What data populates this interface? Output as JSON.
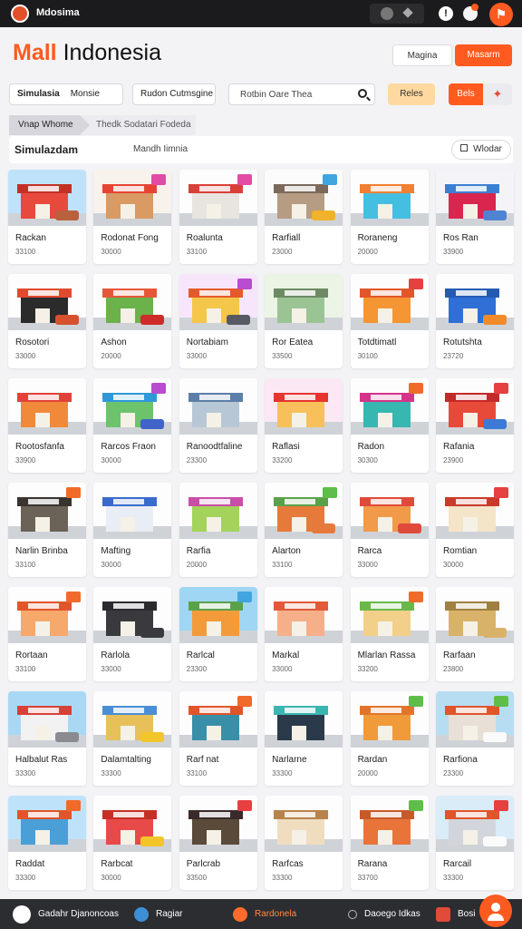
{
  "topbar": {
    "title": "Mdosima"
  },
  "header": {
    "title_accent": "Mall",
    "title_rest": "Indonesia",
    "btn_light": "Magina",
    "btn_dark": "Masarm"
  },
  "toolbar": {
    "tab1_bold": "Simulasia",
    "tab1_rest": "Monsie",
    "tab2": "Rudon Cutmsgine",
    "search_placeholder": "Rotbin Oare Thea",
    "filter": "Reles",
    "go": "Bels"
  },
  "breadcrumb": {
    "first": "Vnap Whome",
    "second": "Thedk Sodatari  Fodeda"
  },
  "section": {
    "title": "Simulazdam",
    "subtitle": "Mandh Iimnia",
    "button": "Wlodar"
  },
  "colors": {
    "accent": "#ff5a1f",
    "topbar": "#1b1b1d",
    "bottombar": "#2b2d31"
  },
  "items": [
    {
      "name": "Rackan",
      "price": "33100",
      "sky": "#bfe2fb",
      "body": "#e8493d",
      "roof": "#c43025",
      "car": "#b9603e",
      "badge": ""
    },
    {
      "name": "Rodonat Fong",
      "price": "30000",
      "sky": "#f7f3ec",
      "body": "#d99a63",
      "roof": "#e74533",
      "car": "",
      "badge": "#e24ba6"
    },
    {
      "name": "Roalunta",
      "price": "33100",
      "sky": "#fdfdfd",
      "body": "#e8e4df",
      "roof": "#d94038",
      "car": "",
      "badge": "#e24ba6"
    },
    {
      "name": "Rarfiall",
      "price": "23000",
      "sky": "#fbfbfb",
      "body": "#b59c82",
      "roof": "#7b6a5a",
      "car": "#f0b12b",
      "badge": "#41a5e0"
    },
    {
      "name": "Roraneng",
      "price": "20000",
      "sky": "#fdfdfd",
      "body": "#45bfe1",
      "roof": "#f37f30",
      "car": "",
      "badge": ""
    },
    {
      "name": "Ros Ran",
      "price": "33900",
      "sky": "#f4f4f8",
      "body": "#d8264e",
      "roof": "#3b7fd4",
      "car": "#4f83d1",
      "badge": ""
    },
    {
      "name": "Rosotori",
      "price": "33000",
      "sky": "#fdfdfd",
      "body": "#2b2b2b",
      "roof": "#e24a2e",
      "car": "#d6522f",
      "badge": ""
    },
    {
      "name": "Ashon",
      "price": "20000",
      "sky": "#fdfdfd",
      "body": "#6bb24a",
      "roof": "#e6573a",
      "car": "#cf2b2b",
      "badge": ""
    },
    {
      "name": "Nortabiam",
      "price": "33000",
      "sky": "#f7e6fb",
      "body": "#f4c64a",
      "roof": "#e45a2c",
      "car": "#575a63",
      "badge": "#b84dcf"
    },
    {
      "name": "Ror Eatea",
      "price": "33500",
      "sky": "#ecf4e6",
      "body": "#9ac493",
      "roof": "#6d8a64",
      "car": "",
      "badge": ""
    },
    {
      "name": "Totdtimatl",
      "price": "30100",
      "sky": "#fdfdfd",
      "body": "#f59534",
      "roof": "#e3552a",
      "car": "",
      "badge": "#e74040"
    },
    {
      "name": "Rotutshta",
      "price": "23720",
      "sky": "#fdfdfd",
      "body": "#2f6fd6",
      "roof": "#245bb2",
      "car": "#f08a2a",
      "badge": ""
    },
    {
      "name": "Rootosfanfa",
      "price": "33900",
      "sky": "#fdfdfd",
      "body": "#f08a3a",
      "roof": "#e2423a",
      "car": "",
      "badge": ""
    },
    {
      "name": "Rarcos Fraon",
      "price": "30000",
      "sky": "#fdfdfd",
      "body": "#6dc36b",
      "roof": "#2e98d9",
      "car": "#3f63c8",
      "badge": "#b84dcf"
    },
    {
      "name": "Ranoodtfaline",
      "price": "23300",
      "sky": "#fdfdfd",
      "body": "#b8c7d6",
      "roof": "#5b7fa8",
      "car": "",
      "badge": ""
    },
    {
      "name": "Raflasi",
      "price": "33200",
      "sky": "#fbe8f4",
      "body": "#f7c05a",
      "roof": "#e4352f",
      "car": "",
      "badge": ""
    },
    {
      "name": "Radon",
      "price": "30300",
      "sky": "#fdfdfd",
      "body": "#37b7b0",
      "roof": "#d6338a",
      "car": "",
      "badge": "#f06a2a"
    },
    {
      "name": "Rafania",
      "price": "23900",
      "sky": "#fdfdfd",
      "body": "#e84a3a",
      "roof": "#c32a2a",
      "car": "#3d7ad6",
      "badge": "#e74040"
    },
    {
      "name": "Narlin Brinba",
      "price": "33100",
      "sky": "#fdfdfd",
      "body": "#6b6258",
      "roof": "#3a342f",
      "car": "",
      "badge": "#f06a2a"
    },
    {
      "name": "Mafting",
      "price": "30000",
      "sky": "#fdfdfd",
      "body": "#e9eef6",
      "roof": "#3a6bcc",
      "car": "",
      "badge": ""
    },
    {
      "name": "Rarfia",
      "price": "20000",
      "sky": "#fdfdfd",
      "body": "#a3d35a",
      "roof": "#c94ea8",
      "car": "",
      "badge": ""
    },
    {
      "name": "Alarton",
      "price": "33100",
      "sky": "#fdfdfd",
      "body": "#e67a3a",
      "roof": "#5aa24a",
      "car": "#e67a3a",
      "badge": "#5fbe4a"
    },
    {
      "name": "Rarca",
      "price": "33000",
      "sky": "#fdfdfd",
      "body": "#f09a4a",
      "roof": "#e04a3a",
      "car": "#e04a3a",
      "badge": ""
    },
    {
      "name": "Romtian",
      "price": "30000",
      "sky": "#fdfdfd",
      "body": "#f4e4c8",
      "roof": "#c93a2a",
      "car": "",
      "badge": "#e74040"
    },
    {
      "name": "Rortaan",
      "price": "33100",
      "sky": "#fdfdfd",
      "body": "#f6a96a",
      "roof": "#e2542a",
      "car": "",
      "badge": "#f06a2a"
    },
    {
      "name": "Rarlola",
      "price": "33000",
      "sky": "#fdfdfd",
      "body": "#3a3a3e",
      "roof": "#2a2a2e",
      "car": "#3a3a3e",
      "badge": ""
    },
    {
      "name": "Rarlcal",
      "price": "23300",
      "sky": "#9fd6f3",
      "body": "#f39b3a",
      "roof": "#5aa24a",
      "car": "",
      "badge": "#41a5e0"
    },
    {
      "name": "Markal",
      "price": "33000",
      "sky": "#fdfdfd",
      "body": "#f5b08a",
      "roof": "#e25a3a",
      "car": "",
      "badge": ""
    },
    {
      "name": "Mlarlan Rassa",
      "price": "33200",
      "sky": "#fdfdfd",
      "body": "#f2d08a",
      "roof": "#6ab84a",
      "car": "",
      "badge": "#f06a2a"
    },
    {
      "name": "Rarfaan",
      "price": "23800",
      "sky": "#fdfdfd",
      "body": "#d9b26a",
      "roof": "#a08040",
      "car": "#d9b26a",
      "badge": ""
    },
    {
      "name": "Halbalut Ras",
      "price": "33300",
      "sky": "#a9d8f5",
      "body": "#f2f2f2",
      "roof": "#d94038",
      "car": "#8a8a90",
      "badge": ""
    },
    {
      "name": "Dalamtalting",
      "price": "33300",
      "sky": "#fdfdfd",
      "body": "#e7c05a",
      "roof": "#4a8fd6",
      "car": "#f2c52a",
      "badge": ""
    },
    {
      "name": "Rarf nat",
      "price": "33100",
      "sky": "#fdfdfd",
      "body": "#3a8fa8",
      "roof": "#e2542a",
      "car": "",
      "badge": "#f06a2a"
    },
    {
      "name": "Narlarne",
      "price": "33300",
      "sky": "#fdfdfd",
      "body": "#2a3a4a",
      "roof": "#3ab6b0",
      "car": "",
      "badge": ""
    },
    {
      "name": "Rardan",
      "price": "20000",
      "sky": "#fdfdfd",
      "body": "#f09a3a",
      "roof": "#e2742a",
      "car": "",
      "badge": "#5fbe4a"
    },
    {
      "name": "Rarfiona",
      "price": "23300",
      "sky": "#b7ddf2",
      "body": "#e8e0d6",
      "roof": "#e2542a",
      "car": "#fafafa",
      "badge": "#5fbe4a"
    },
    {
      "name": "Raddat",
      "price": "33300",
      "sky": "#bfe2fb",
      "body": "#4a9fd6",
      "roof": "#e2542a",
      "car": "",
      "badge": "#f06a2a"
    },
    {
      "name": "Rarbcat",
      "price": "30000",
      "sky": "#fdfdfd",
      "body": "#e84a4a",
      "roof": "#c43025",
      "car": "#f2c52a",
      "badge": ""
    },
    {
      "name": "Parlcrab",
      "price": "33500",
      "sky": "#fdfdfd",
      "body": "#5a4a3a",
      "roof": "#3a2a2a",
      "car": "",
      "badge": "#e74040"
    },
    {
      "name": "Rarfcas",
      "price": "33300",
      "sky": "#fdfdfd",
      "body": "#f0ddc0",
      "roof": "#b8834a",
      "car": "",
      "badge": ""
    },
    {
      "name": "Rarana",
      "price": "33700",
      "sky": "#fdfdfd",
      "body": "#e8743a",
      "roof": "#c85a2a",
      "car": "",
      "badge": "#5fbe4a"
    },
    {
      "name": "Rarcail",
      "price": "33300",
      "sky": "#d9ecf8",
      "body": "#d2d6dc",
      "roof": "#e2542a",
      "car": "#fafafa",
      "badge": "#e74040"
    }
  ],
  "bottom_nav": {
    "item1": "Gadahr Djanoncoas",
    "item2": "Ragiar",
    "item3": "Rardonela",
    "item4": "Daoego Idkas",
    "item5": "Bosi"
  }
}
